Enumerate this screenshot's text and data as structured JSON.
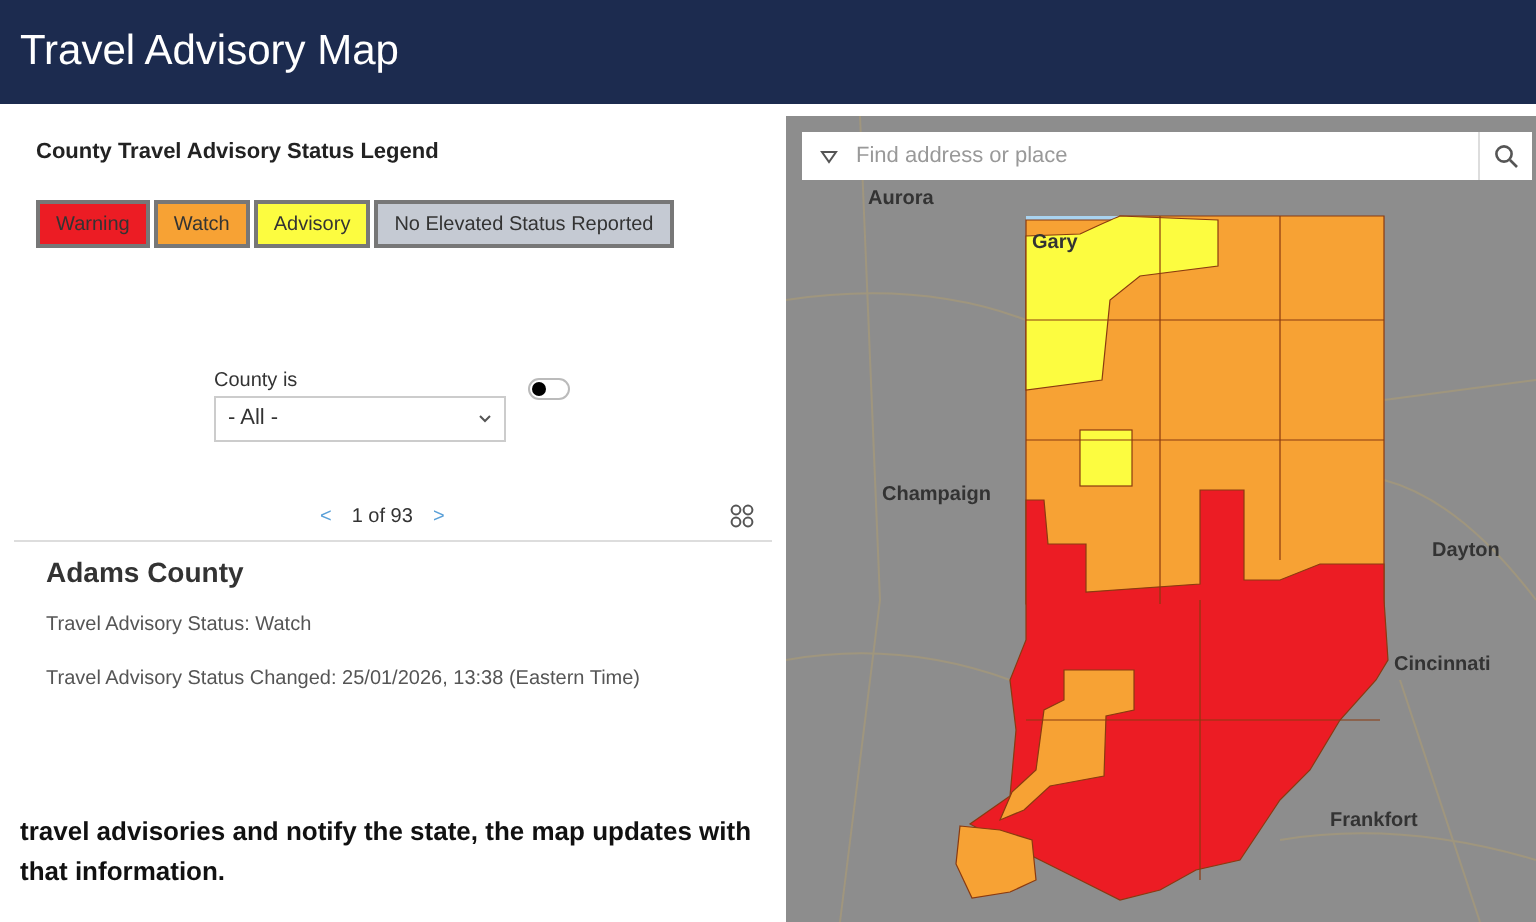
{
  "header": {
    "title": "Travel Advisory Map"
  },
  "legend": {
    "title": "County Travel Advisory Status Legend",
    "items": [
      {
        "label": "Warning",
        "color": "#ec1c24"
      },
      {
        "label": "Watch",
        "color": "#f7a234"
      },
      {
        "label": "Advisory",
        "color": "#fcfc40"
      },
      {
        "label": "No Elevated Status Reported",
        "color": "#c5cad3"
      }
    ]
  },
  "filter": {
    "label": "County is",
    "value": "- All -",
    "toggle_on": false
  },
  "pager": {
    "prev": "<",
    "text": "1 of 93",
    "next": ">"
  },
  "feature": {
    "title": "Adams County",
    "fields": [
      "Travel Advisory Status: Watch",
      "Travel Advisory Status Changed: 25/01/2026, 13:38 (Eastern Time)"
    ]
  },
  "caption": "travel advisories and notify the state, the map updates with that information.",
  "map": {
    "search_placeholder": "Find address or place",
    "places": [
      {
        "label": "Aurora"
      },
      {
        "label": "Gary"
      },
      {
        "label": "Champaign"
      },
      {
        "label": "Dayton"
      },
      {
        "label": "Cincinnati"
      },
      {
        "label": "Frankfort"
      }
    ]
  }
}
